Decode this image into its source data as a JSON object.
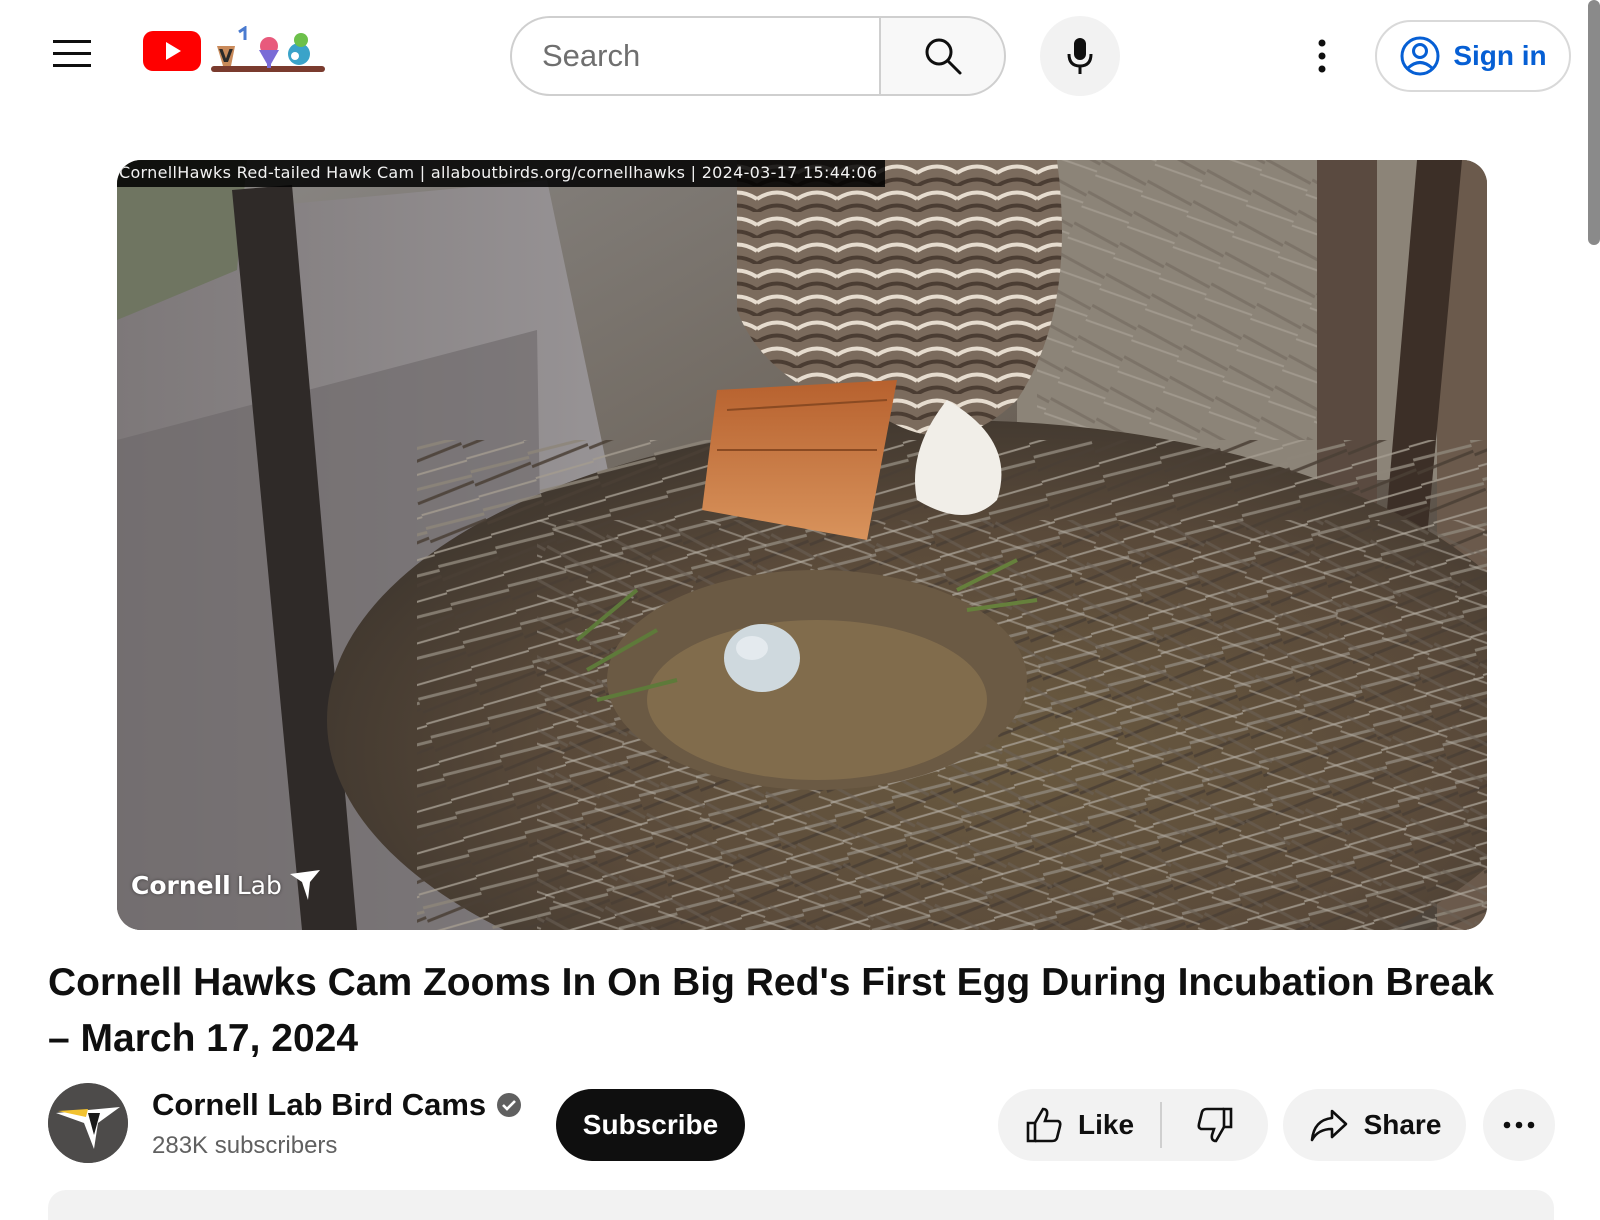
{
  "header": {
    "search_placeholder": "Search",
    "sign_in_label": "Sign in"
  },
  "icons": {
    "menu": "hamburger-menu-icon",
    "logo": "youtube-logo",
    "doodle": "seasonal-doodle",
    "search": "search-icon",
    "mic": "microphone-icon",
    "more": "vertical-dots-icon",
    "account": "account-circle-icon",
    "verified": "verified-check-icon",
    "like": "thumbs-up-icon",
    "dislike": "thumbs-down-icon",
    "share": "share-arrow-icon",
    "actions_more": "horizontal-dots-icon"
  },
  "colors": {
    "brand_red": "#ff0000",
    "link_blue": "#065fd4",
    "subscribe_bg": "#0f0f0f",
    "chip_bg": "#f2f2f2"
  },
  "video": {
    "cam_overlay": "CornellHawks Red-tailed Hawk Cam | allaboutbirds.org/cornellhawks | 2024-03-17 15:44:06",
    "watermark_bold": "Cornell",
    "watermark_light": "Lab",
    "title": "Cornell Hawks Cam Zooms In On Big Red's First Egg During Incubation Break – March 17, 2024"
  },
  "owner": {
    "channel_name": "Cornell Lab Bird Cams",
    "subscribers": "283K subscribers",
    "subscribe_label": "Subscribe"
  },
  "actions": {
    "like_label": "Like",
    "share_label": "Share"
  }
}
